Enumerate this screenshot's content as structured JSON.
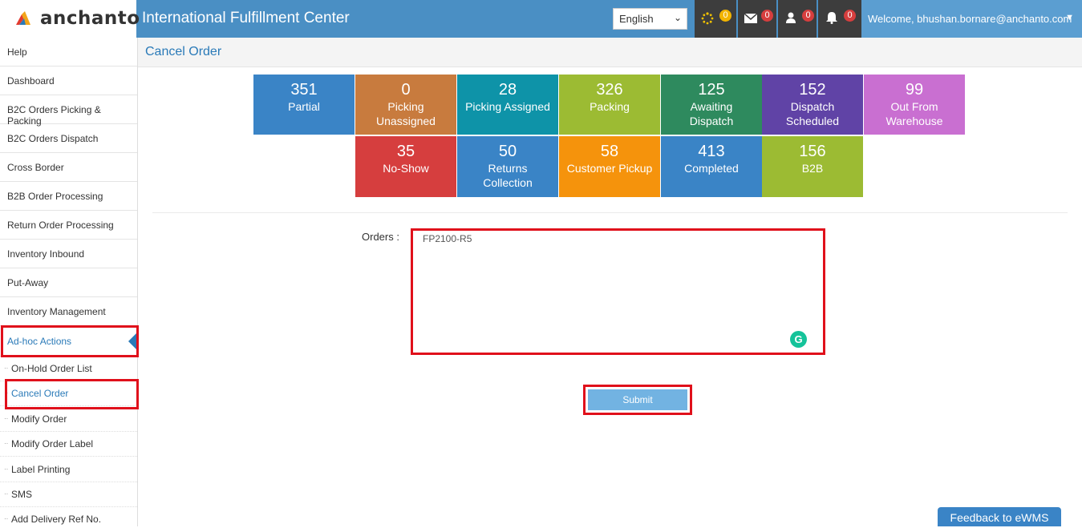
{
  "header": {
    "logo_text": "anchanto",
    "app_title": "International Fulfillment Center",
    "language": "English",
    "badges": {
      "tasks": "0",
      "messages": "0",
      "users": "0",
      "alerts": "0"
    },
    "welcome": "Welcome, bhushan.bornare@anchanto.com"
  },
  "sidebar": {
    "items": [
      "Help",
      "Dashboard",
      "B2C Orders Picking & Packing",
      "B2C Orders Dispatch",
      "Cross Border",
      "B2B Order Processing",
      "Return Order Processing",
      "Inventory Inbound",
      "Put-Away",
      "Inventory Management",
      "Ad-hoc Actions"
    ],
    "sub_items": [
      "On-Hold Order List",
      "Cancel Order",
      "Modify Order",
      "Modify Order Label",
      "Label Printing",
      "SMS",
      "Add Delivery Ref No."
    ]
  },
  "page": {
    "title": "Cancel Order"
  },
  "tiles": [
    {
      "count": "351",
      "label": "Partial",
      "color": "#3a84c6"
    },
    {
      "count": "0",
      "label": "Picking Unassigned",
      "color": "#c87b3e"
    },
    {
      "count": "28",
      "label": "Picking Assigned",
      "color": "#0e93a8"
    },
    {
      "count": "326",
      "label": "Packing",
      "color": "#9cbb33"
    },
    {
      "count": "125",
      "label": "Awaiting Dispatch",
      "color": "#2e8a5e"
    },
    {
      "count": "152",
      "label": "Dispatch Scheduled",
      "color": "#6043a6"
    },
    {
      "count": "99",
      "label": "Out From Warehouse",
      "color": "#c96fd1"
    },
    {
      "count": "35",
      "label": "No-Show",
      "color": "#d63e3e"
    },
    {
      "count": "50",
      "label": "Returns Collection",
      "color": "#3a84c6"
    },
    {
      "count": "58",
      "label": "Customer Pickup",
      "color": "#f5930c"
    },
    {
      "count": "413",
      "label": "Completed",
      "color": "#3a84c6"
    },
    {
      "count": "156",
      "label": "B2B",
      "color": "#9cbb33"
    }
  ],
  "form": {
    "orders_label": "Orders :",
    "orders_value": "FP2100-R5",
    "submit_label": "Submit"
  },
  "feedback_label": "Feedback to eWMS"
}
